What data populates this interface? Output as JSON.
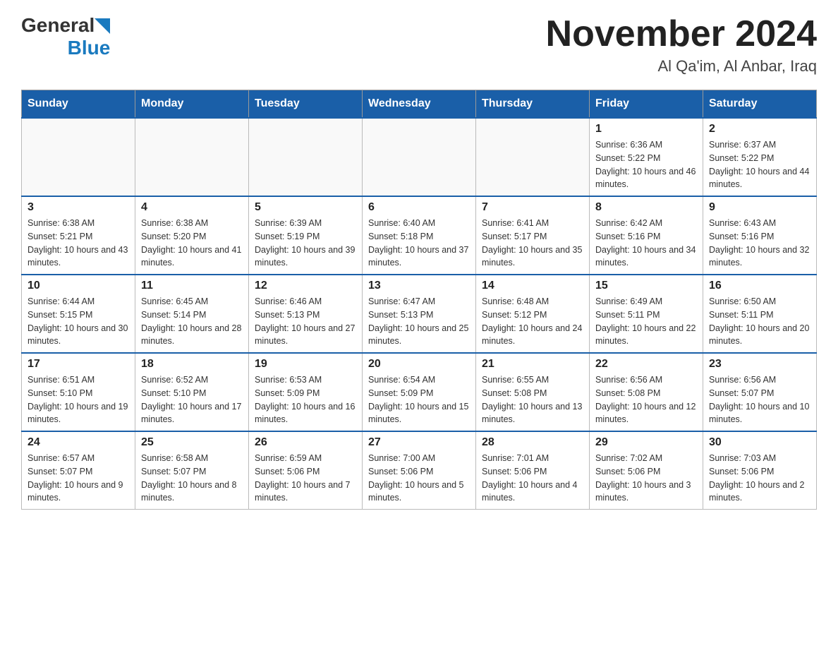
{
  "header": {
    "logo_general": "General",
    "logo_blue": "Blue",
    "month_title": "November 2024",
    "location": "Al Qa'im, Al Anbar, Iraq"
  },
  "calendar": {
    "days_of_week": [
      "Sunday",
      "Monday",
      "Tuesday",
      "Wednesday",
      "Thursday",
      "Friday",
      "Saturday"
    ],
    "weeks": [
      [
        {
          "day": "",
          "info": ""
        },
        {
          "day": "",
          "info": ""
        },
        {
          "day": "",
          "info": ""
        },
        {
          "day": "",
          "info": ""
        },
        {
          "day": "",
          "info": ""
        },
        {
          "day": "1",
          "info": "Sunrise: 6:36 AM\nSunset: 5:22 PM\nDaylight: 10 hours and 46 minutes."
        },
        {
          "day": "2",
          "info": "Sunrise: 6:37 AM\nSunset: 5:22 PM\nDaylight: 10 hours and 44 minutes."
        }
      ],
      [
        {
          "day": "3",
          "info": "Sunrise: 6:38 AM\nSunset: 5:21 PM\nDaylight: 10 hours and 43 minutes."
        },
        {
          "day": "4",
          "info": "Sunrise: 6:38 AM\nSunset: 5:20 PM\nDaylight: 10 hours and 41 minutes."
        },
        {
          "day": "5",
          "info": "Sunrise: 6:39 AM\nSunset: 5:19 PM\nDaylight: 10 hours and 39 minutes."
        },
        {
          "day": "6",
          "info": "Sunrise: 6:40 AM\nSunset: 5:18 PM\nDaylight: 10 hours and 37 minutes."
        },
        {
          "day": "7",
          "info": "Sunrise: 6:41 AM\nSunset: 5:17 PM\nDaylight: 10 hours and 35 minutes."
        },
        {
          "day": "8",
          "info": "Sunrise: 6:42 AM\nSunset: 5:16 PM\nDaylight: 10 hours and 34 minutes."
        },
        {
          "day": "9",
          "info": "Sunrise: 6:43 AM\nSunset: 5:16 PM\nDaylight: 10 hours and 32 minutes."
        }
      ],
      [
        {
          "day": "10",
          "info": "Sunrise: 6:44 AM\nSunset: 5:15 PM\nDaylight: 10 hours and 30 minutes."
        },
        {
          "day": "11",
          "info": "Sunrise: 6:45 AM\nSunset: 5:14 PM\nDaylight: 10 hours and 28 minutes."
        },
        {
          "day": "12",
          "info": "Sunrise: 6:46 AM\nSunset: 5:13 PM\nDaylight: 10 hours and 27 minutes."
        },
        {
          "day": "13",
          "info": "Sunrise: 6:47 AM\nSunset: 5:13 PM\nDaylight: 10 hours and 25 minutes."
        },
        {
          "day": "14",
          "info": "Sunrise: 6:48 AM\nSunset: 5:12 PM\nDaylight: 10 hours and 24 minutes."
        },
        {
          "day": "15",
          "info": "Sunrise: 6:49 AM\nSunset: 5:11 PM\nDaylight: 10 hours and 22 minutes."
        },
        {
          "day": "16",
          "info": "Sunrise: 6:50 AM\nSunset: 5:11 PM\nDaylight: 10 hours and 20 minutes."
        }
      ],
      [
        {
          "day": "17",
          "info": "Sunrise: 6:51 AM\nSunset: 5:10 PM\nDaylight: 10 hours and 19 minutes."
        },
        {
          "day": "18",
          "info": "Sunrise: 6:52 AM\nSunset: 5:10 PM\nDaylight: 10 hours and 17 minutes."
        },
        {
          "day": "19",
          "info": "Sunrise: 6:53 AM\nSunset: 5:09 PM\nDaylight: 10 hours and 16 minutes."
        },
        {
          "day": "20",
          "info": "Sunrise: 6:54 AM\nSunset: 5:09 PM\nDaylight: 10 hours and 15 minutes."
        },
        {
          "day": "21",
          "info": "Sunrise: 6:55 AM\nSunset: 5:08 PM\nDaylight: 10 hours and 13 minutes."
        },
        {
          "day": "22",
          "info": "Sunrise: 6:56 AM\nSunset: 5:08 PM\nDaylight: 10 hours and 12 minutes."
        },
        {
          "day": "23",
          "info": "Sunrise: 6:56 AM\nSunset: 5:07 PM\nDaylight: 10 hours and 10 minutes."
        }
      ],
      [
        {
          "day": "24",
          "info": "Sunrise: 6:57 AM\nSunset: 5:07 PM\nDaylight: 10 hours and 9 minutes."
        },
        {
          "day": "25",
          "info": "Sunrise: 6:58 AM\nSunset: 5:07 PM\nDaylight: 10 hours and 8 minutes."
        },
        {
          "day": "26",
          "info": "Sunrise: 6:59 AM\nSunset: 5:06 PM\nDaylight: 10 hours and 7 minutes."
        },
        {
          "day": "27",
          "info": "Sunrise: 7:00 AM\nSunset: 5:06 PM\nDaylight: 10 hours and 5 minutes."
        },
        {
          "day": "28",
          "info": "Sunrise: 7:01 AM\nSunset: 5:06 PM\nDaylight: 10 hours and 4 minutes."
        },
        {
          "day": "29",
          "info": "Sunrise: 7:02 AM\nSunset: 5:06 PM\nDaylight: 10 hours and 3 minutes."
        },
        {
          "day": "30",
          "info": "Sunrise: 7:03 AM\nSunset: 5:06 PM\nDaylight: 10 hours and 2 minutes."
        }
      ]
    ]
  }
}
